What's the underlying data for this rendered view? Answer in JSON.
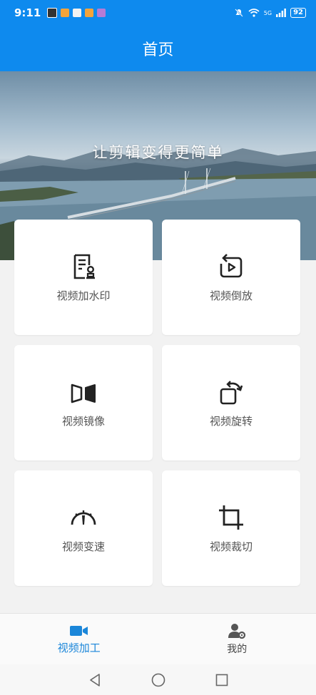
{
  "status_bar": {
    "time": "9:11",
    "battery": "92",
    "signal_text": "5G"
  },
  "app_bar": {
    "title": "首页"
  },
  "banner": {
    "slogan": "让剪辑变得更简单"
  },
  "features": [
    {
      "label": "视频加水印",
      "icon": "watermark-icon"
    },
    {
      "label": "视频倒放",
      "icon": "reverse-play-icon"
    },
    {
      "label": "视频镜像",
      "icon": "mirror-icon"
    },
    {
      "label": "视频旋转",
      "icon": "rotate-icon"
    },
    {
      "label": "视频变速",
      "icon": "speedometer-icon"
    },
    {
      "label": "视频裁切",
      "icon": "crop-icon"
    }
  ],
  "bottom_nav": [
    {
      "label": "视频加工",
      "icon": "video-camera-icon",
      "active": true
    },
    {
      "label": "我的",
      "icon": "user-settings-icon",
      "active": false
    }
  ],
  "colors": {
    "primary": "#0e8aee",
    "active_nav": "#1b86d9"
  }
}
